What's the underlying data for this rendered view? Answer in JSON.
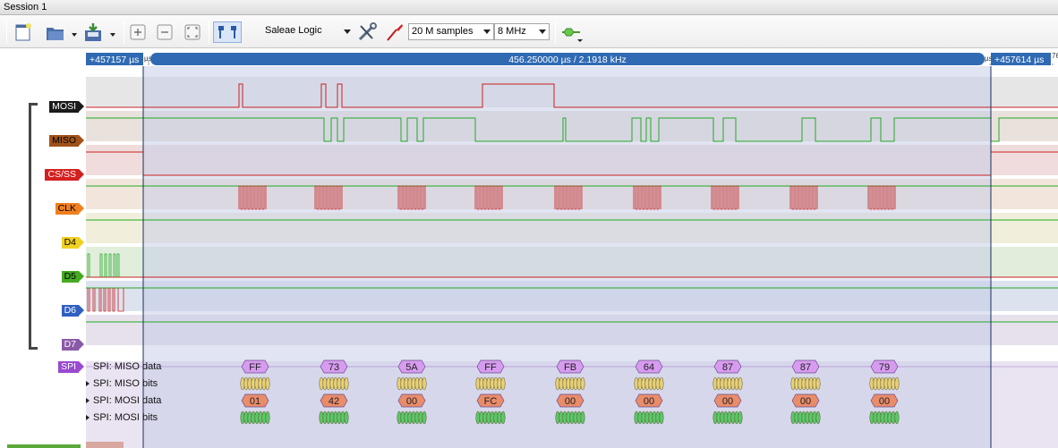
{
  "window": {
    "title": "Session 1"
  },
  "toolbar": {
    "session_name": "Saleae Logic",
    "samples": "20 M samples",
    "rate": "8 MHz"
  },
  "timeline": {
    "left_time": "+457157 µs",
    "right_time": "+457614 µs",
    "measurement": "456.250000 µs / 2.1918 kHz",
    "edge_marks": [
      "µs",
      "µs",
      "76"
    ]
  },
  "channels": [
    {
      "name": "MOSI",
      "color": "#1a1a1a"
    },
    {
      "name": "MISO",
      "color": "#a0521a"
    },
    {
      "name": "CS/SS",
      "color": "#d42020"
    },
    {
      "name": "CLK",
      "color": "#f08020"
    },
    {
      "name": "D4",
      "color": "#f0d020"
    },
    {
      "name": "D5",
      "color": "#44aa22"
    },
    {
      "name": "D6",
      "color": "#3060c0"
    },
    {
      "name": "D7",
      "color": "#8a5aa8"
    }
  ],
  "analyzer": {
    "name": "SPI",
    "color": "#9a4ad0",
    "rows": [
      "SPI: MISO data",
      "SPI: MISO bits",
      "SPI: MOSI data",
      "SPI: MOSI bits"
    ]
  },
  "spi_miso": [
    "FF",
    "73",
    "5A",
    "FF",
    "FB",
    "64",
    "87",
    "87",
    "79"
  ],
  "spi_mosi": [
    "01",
    "42",
    "00",
    "FC",
    "00",
    "00",
    "00",
    "00",
    "00"
  ],
  "colors": {
    "miso_frame": "#d79cf0",
    "mosi_frame": "#e98c6a",
    "miso_bits": "#e8d07a",
    "mosi_bits": "#5cc86a",
    "selection": "#c3c9e6",
    "timebar": "#2f6ab3"
  }
}
